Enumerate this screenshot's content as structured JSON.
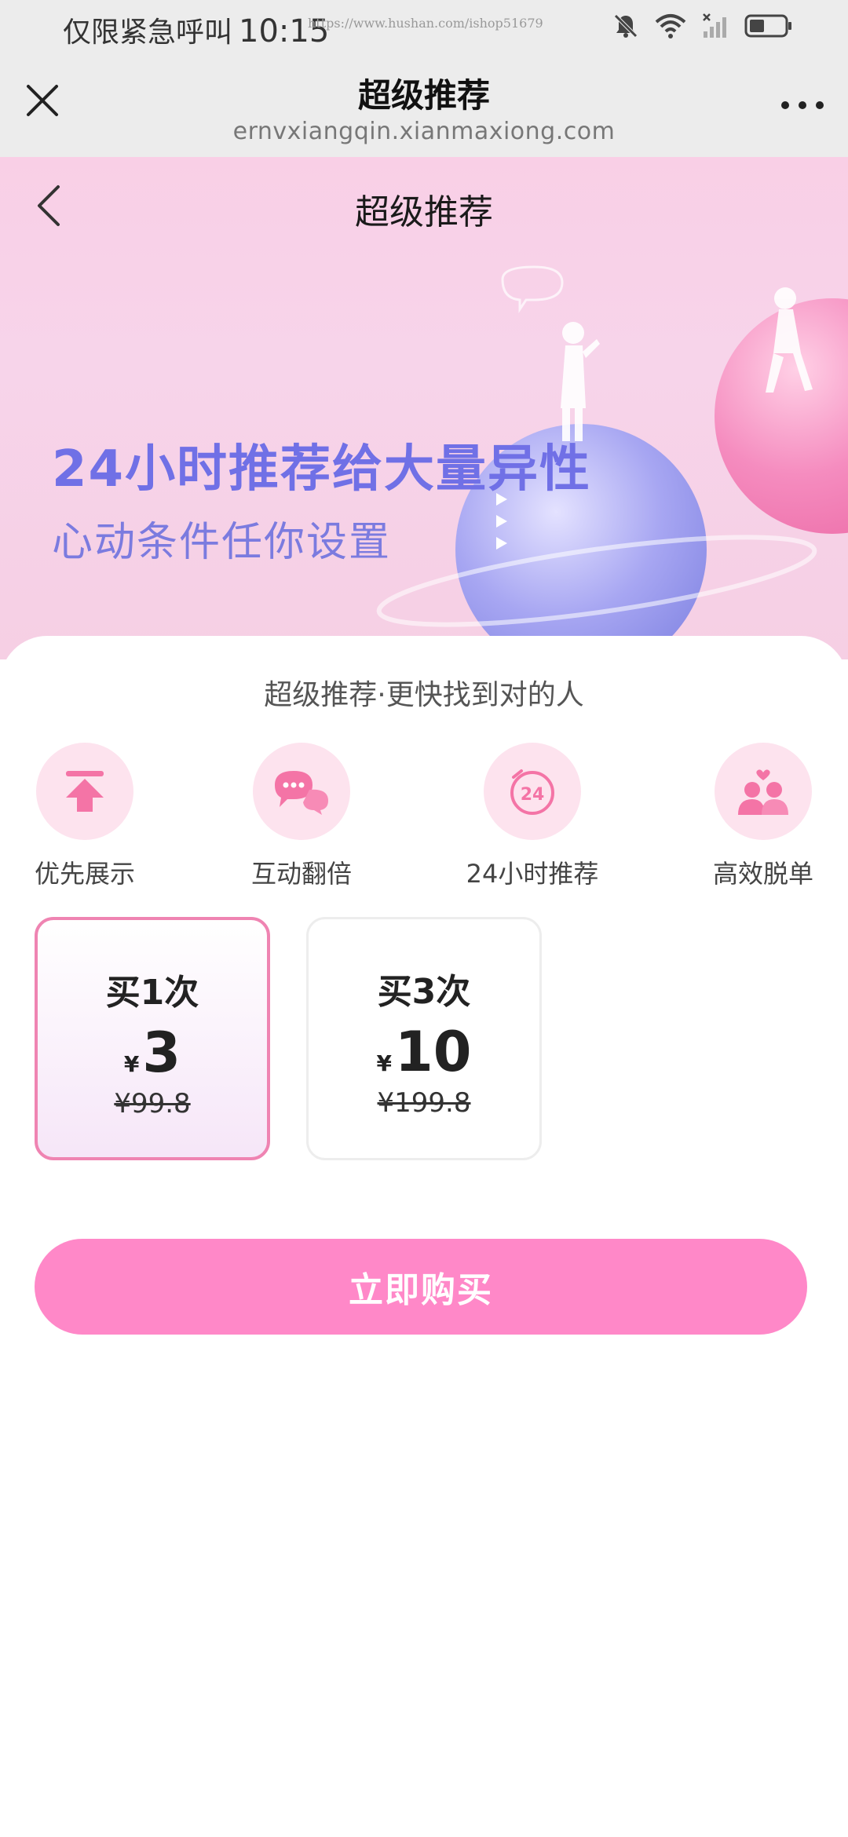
{
  "status_bar": {
    "carrier_text": "仅限紧急呼叫",
    "time": "10:15",
    "watermark": "https://www.hushan.com/ishop51679"
  },
  "browser": {
    "title": "超级推荐",
    "url": "ernvxiangqin.xianmaxiong.com"
  },
  "hero": {
    "page_title": "超级推荐",
    "headline": "24小时推荐给大量异性",
    "subheadline": "心动条件任你设置"
  },
  "panel": {
    "subtitle": "超级推荐·更快找到对的人",
    "features": [
      {
        "label": "优先展示",
        "icon": "priority-up-icon"
      },
      {
        "label": "互动翻倍",
        "icon": "chat-bubbles-icon"
      },
      {
        "label": "24小时推荐",
        "icon": "clock-24-icon"
      },
      {
        "label": "高效脱单",
        "icon": "couple-heart-icon"
      }
    ],
    "options": [
      {
        "title": "买1次",
        "currency": "¥",
        "price": "3",
        "original": "¥99.8",
        "selected": true
      },
      {
        "title": "买3次",
        "currency": "¥",
        "price": "10",
        "original": "¥199.8",
        "selected": false
      }
    ],
    "buy_label": "立即购买"
  },
  "colors": {
    "accent_pink": "#ff88c8",
    "hero_text": "#7070e6",
    "icon_pink": "#f474a6"
  }
}
